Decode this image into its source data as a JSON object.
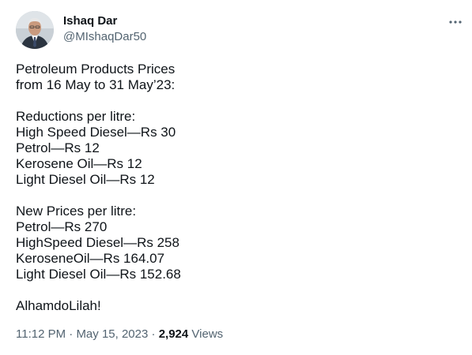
{
  "author": {
    "display_name": "Ishaq Dar",
    "handle": "@MIshaqDar50",
    "avatar_icon": "profile-photo-icon"
  },
  "more_icon": "more-options-icon",
  "tweet": {
    "lines": [
      "Petroleum Products Prices",
      "from 16 May to 31 May’23:",
      "",
      "Reductions per litre:",
      "High Speed Diesel—Rs 30",
      "Petrol—Rs 12",
      "Kerosene Oil—Rs 12",
      "Light Diesel Oil—Rs 12",
      "",
      "New Prices per litre:",
      "Petrol—Rs 270",
      "HighSpeed Diesel—Rs 258",
      "KeroseneOil—Rs 164.07",
      "Light Diesel Oil—Rs 152.68",
      "",
      "AlhamdoLilah!"
    ]
  },
  "meta": {
    "time": "11:12 PM",
    "separator": "·",
    "date": "May 15, 2023",
    "views_count": "2,924",
    "views_label": "Views"
  },
  "colors": {
    "text": "#0f1419",
    "secondary": "#536471",
    "background": "#ffffff"
  }
}
